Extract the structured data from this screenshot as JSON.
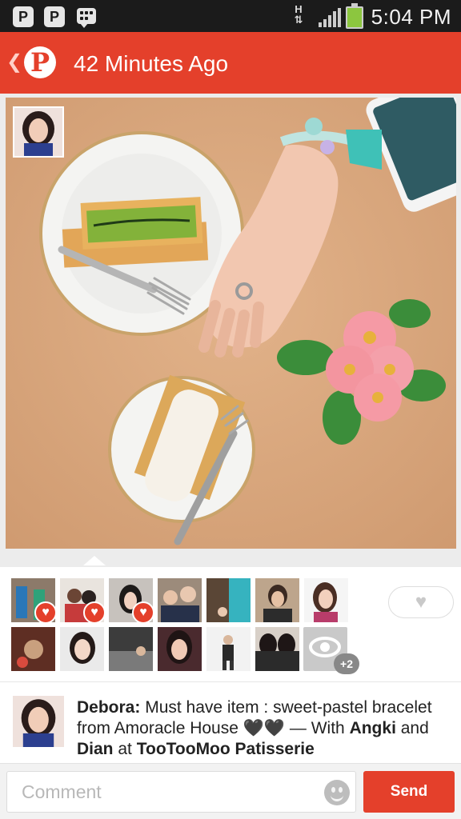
{
  "status_bar": {
    "time": "5:04 PM",
    "network_type": "H",
    "app_icons": [
      "pinterest-icon",
      "pinterest-icon",
      "bbm-icon"
    ],
    "battery_color": "#8cc63f"
  },
  "header": {
    "logo_glyph": "P",
    "back_glyph": "❮",
    "title": "42 Minutes Ago",
    "color": "#e4402b"
  },
  "likes": {
    "liked_count_badges": 3,
    "extra_viewers": "+2",
    "like_button_icon": "heart-icon"
  },
  "caption": {
    "author": "Debora:",
    "text": "Must have item : sweet-pastel bracelet from Amoracle House 🖤🖤 — With",
    "with_1": "Angki",
    "and": "and",
    "with_2": "Dian",
    "at": "at",
    "place": "TooTooMoo Patisserie"
  },
  "comment_bar": {
    "placeholder": "Comment",
    "send_label": "Send"
  }
}
